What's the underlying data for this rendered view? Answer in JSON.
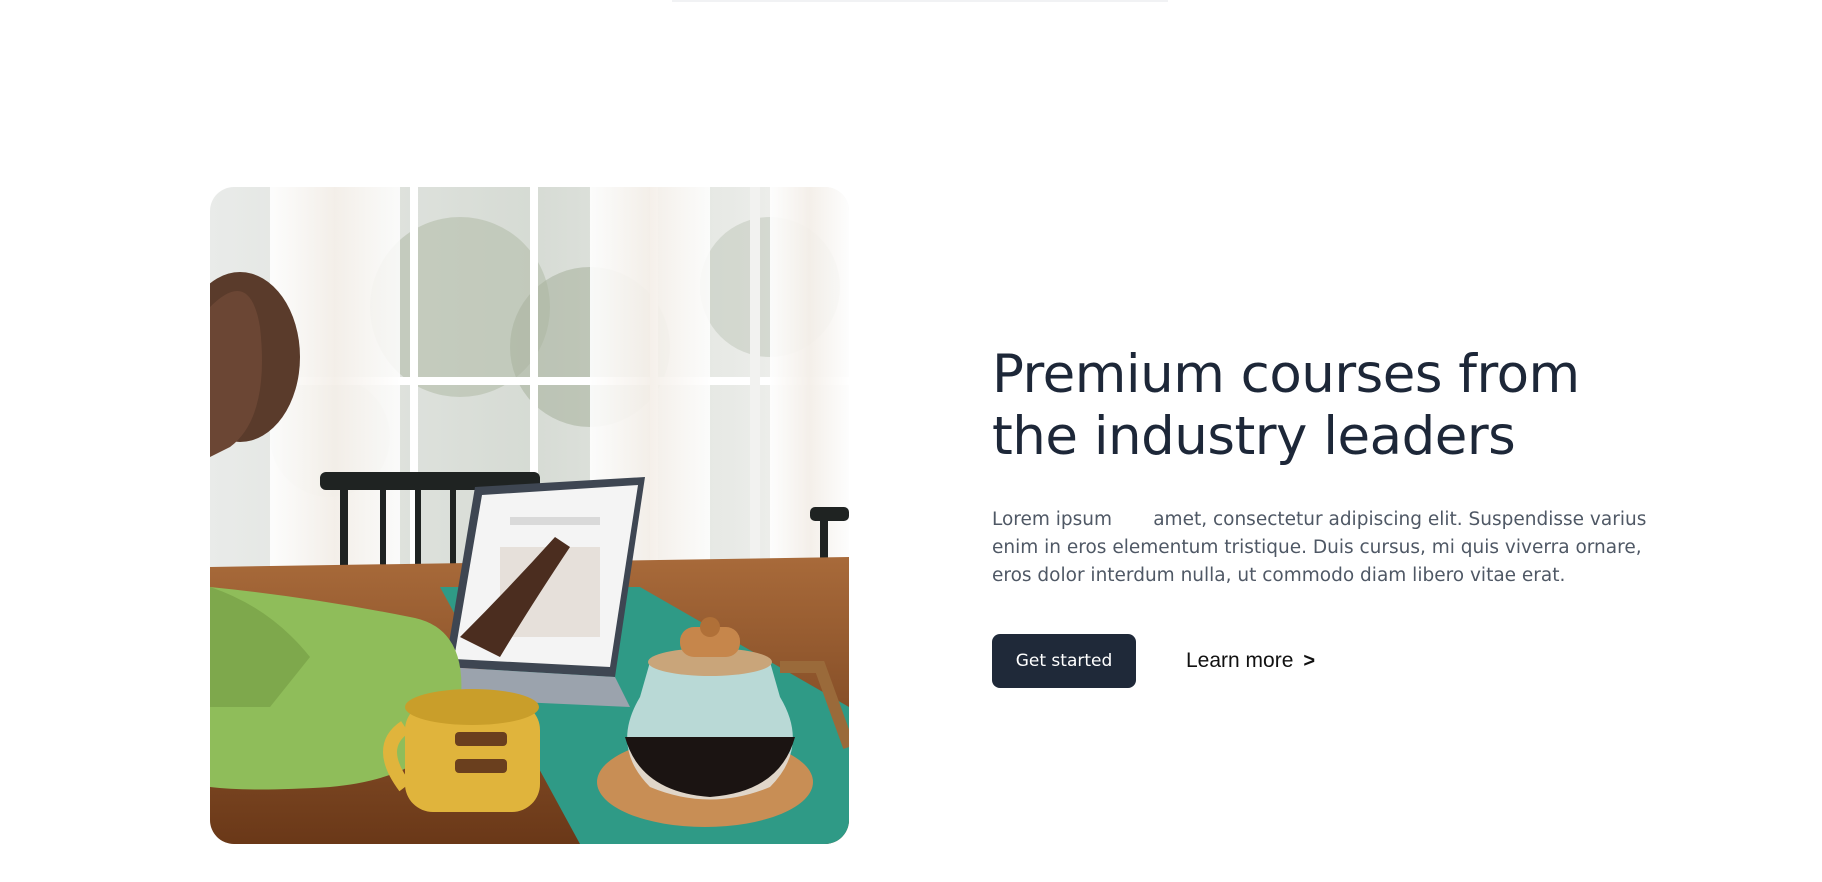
{
  "hero": {
    "image_alt": "Person using laptop at a table with coffee mug and coffee pot",
    "headline": "Premium courses from the industry leaders",
    "body": "Lorem ipsum       amet, consectetur adipiscing elit. Suspendisse varius enim in eros elementum tristique. Duis cursus, mi quis viverra ornare, eros dolor interdum nulla, ut commodo diam libero vitae erat.",
    "primary_button": "Get started",
    "secondary_link": "Learn more",
    "secondary_icon": "chevron-right-icon"
  },
  "colors": {
    "heading": "#1d2738",
    "body": "#4f5865",
    "button_bg": "#1f2939",
    "button_text": "#ffffff"
  }
}
